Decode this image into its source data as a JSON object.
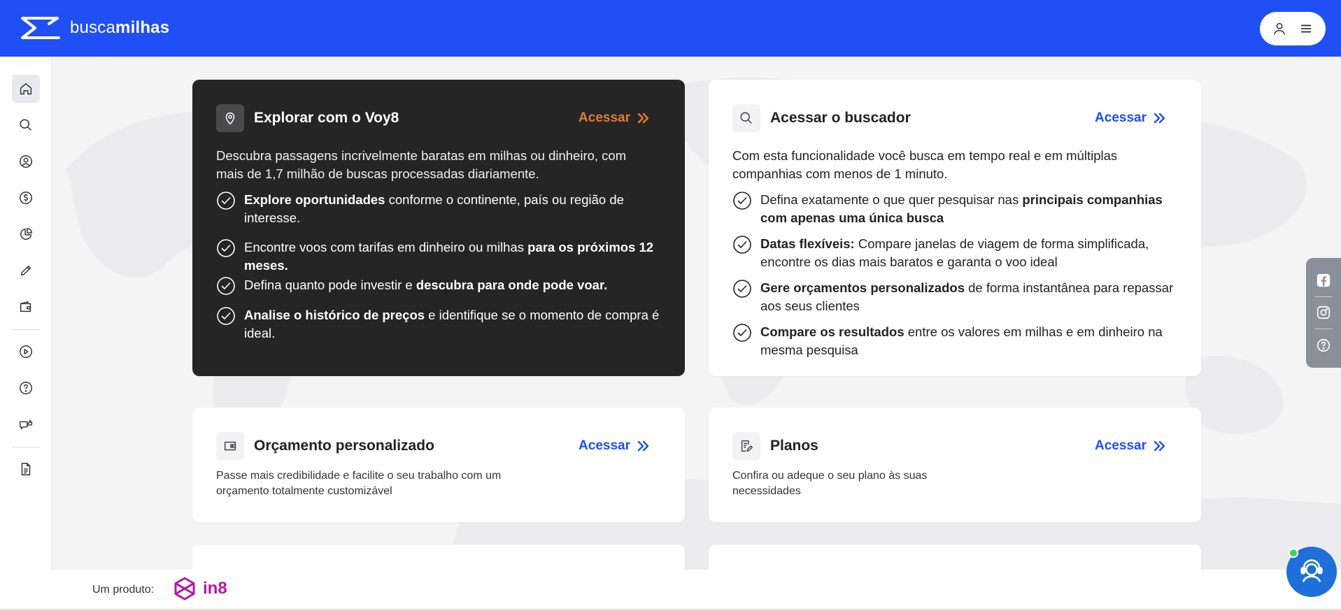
{
  "header": {
    "logo_text_light": "busca",
    "logo_text_bold": "milhas"
  },
  "sidebar": {
    "items": [
      {
        "icon": "home-icon",
        "active": true
      },
      {
        "icon": "search-icon"
      },
      {
        "icon": "location-icon"
      },
      {
        "icon": "dollar-icon"
      },
      {
        "icon": "pie-chart-icon"
      },
      {
        "icon": "pencil-icon"
      },
      {
        "icon": "wallet-icon"
      },
      {
        "icon": "play-icon"
      },
      {
        "icon": "help-icon"
      },
      {
        "icon": "chat-thumbs-icon"
      },
      {
        "icon": "document-icon"
      }
    ]
  },
  "cards": {
    "voy8": {
      "title": "Explorar com o Voy8",
      "access": "Acessar",
      "desc": "Descubra passagens incrivelmente baratas em milhas ou dinheiro, com mais de 1,7 milhão de buscas processadas diariamente.",
      "features": [
        {
          "bold": "Explore oportunidades",
          "rest": " conforme o continente, país ou região de interesse."
        },
        {
          "pre": "Encontre voos com tarifas em dinheiro ou milhas ",
          "bold": "para os próximos 12 meses."
        },
        {
          "pre": "Defina quanto pode investir e ",
          "bold": "descubra para onde pode voar."
        },
        {
          "bold": "Analise o histórico de preços",
          "rest": " e identifique se o momento de compra é ideal."
        }
      ]
    },
    "buscador": {
      "title": "Acessar o buscador",
      "access": "Acessar",
      "desc": "Com esta funcionalidade você busca em tempo real e em múltiplas companhias com menos de 1 minuto.",
      "features": [
        {
          "pre": "Defina exatamente o que quer pesquisar nas ",
          "bold": "principais companhias com apenas uma única busca"
        },
        {
          "bold": "Datas flexíveis:",
          "rest": " Compare janelas de viagem de forma simplificada, encontre os dias mais baratos e garanta o voo ideal"
        },
        {
          "bold": "Gere orçamentos personalizados",
          "rest": " de forma instantânea para repassar aos seus clientes"
        },
        {
          "bold": "Compare os resultados",
          "rest": " entre os valores em milhas e em dinheiro na mesma pesquisa"
        }
      ]
    },
    "orcamento": {
      "title": "Orçamento personalizado",
      "access": "Acessar",
      "desc": "Passe mais credibilidade e facilite o seu trabalho com um orçamento totalmente customizável"
    },
    "planos": {
      "title": "Planos",
      "access": "Acessar",
      "desc": "Confira ou adeque o seu plano às suas necessidades"
    }
  },
  "social": [
    "facebook-icon",
    "instagram-icon",
    "help-icon"
  ],
  "footer": {
    "label": "Um produto:",
    "brand": "in8"
  },
  "colors": {
    "primary": "#1f4ff5",
    "dark_card": "#252526",
    "accent_orange": "#e07b34",
    "in8_brand": "#b01aa6"
  }
}
